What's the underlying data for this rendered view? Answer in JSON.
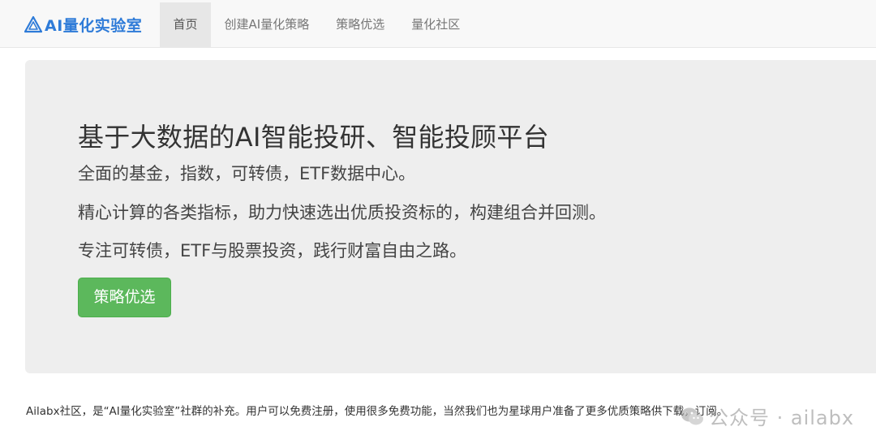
{
  "navbar": {
    "brand": "AI量化实验室",
    "brand_icon": "triangle-logo-icon",
    "brand_color": "#2e7bd8",
    "items": [
      {
        "label": "首页",
        "active": true
      },
      {
        "label": "创建AI量化策略",
        "active": false
      },
      {
        "label": "策略优选",
        "active": false
      },
      {
        "label": "量化社区",
        "active": false
      }
    ]
  },
  "hero": {
    "title": "基于大数据的AI智能投研、智能投顾平台",
    "line1": "全面的基金，指数，可转债，ETF数据中心。",
    "line2": "精心计算的各类指标，助力快速选出优质投资标的，构建组合并回测。",
    "line3": "专注可转债，ETF与股票投资，践行财富自由之路。",
    "button_label": "策略优选",
    "button_color": "#5cb85c"
  },
  "footer": {
    "text": "Ailabx社区，是“AI量化实验室”社群的补充。用户可以免费注册，使用很多免费功能，当然我们也为星球用户准备了更多优质策略供下载，订阅。"
  },
  "watermark": {
    "icon": "wechat-icon",
    "text": "公众号 · ailabx"
  }
}
